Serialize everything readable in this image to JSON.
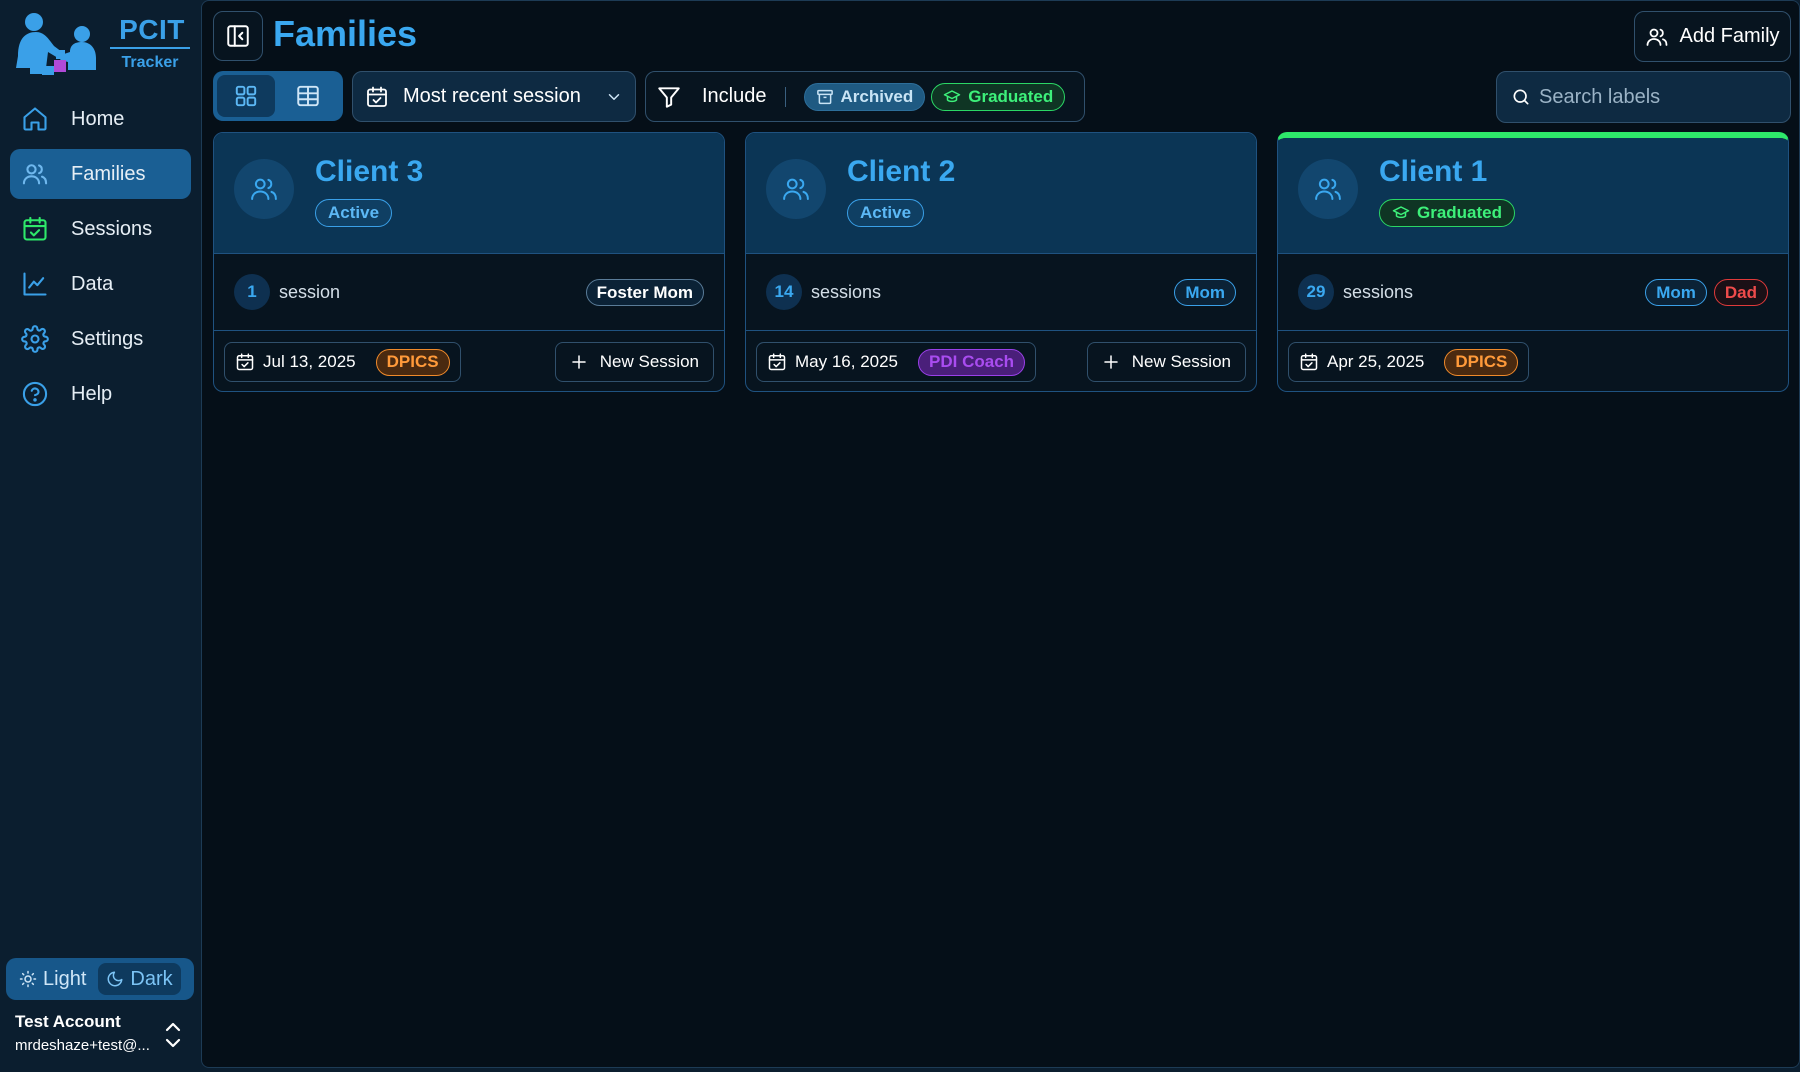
{
  "app": {
    "logo_title": "PCIT",
    "logo_subtitle": "Tracker"
  },
  "sidebar": {
    "items": [
      {
        "label": "Home",
        "icon": "home-icon",
        "active": false
      },
      {
        "label": "Families",
        "icon": "users-icon",
        "active": true
      },
      {
        "label": "Sessions",
        "icon": "calendar-check-icon",
        "active": false
      },
      {
        "label": "Data",
        "icon": "line-chart-icon",
        "active": false
      },
      {
        "label": "Settings",
        "icon": "gear-icon",
        "active": false
      },
      {
        "label": "Help",
        "icon": "help-circle-icon",
        "active": false
      }
    ],
    "theme": {
      "light_label": "Light",
      "dark_label": "Dark",
      "selected": "Dark"
    },
    "account": {
      "name": "Test Account",
      "email": "mrdeshaze+test@..."
    }
  },
  "header": {
    "title": "Families",
    "add_family_label": "Add Family"
  },
  "toolbar": {
    "view_modes": [
      "grid",
      "table"
    ],
    "view_selected": "grid",
    "sort_value": "Most recent session",
    "filter_label": "Include",
    "filter_chips": [
      {
        "label": "Archived",
        "icon": "archive-icon"
      },
      {
        "label": "Graduated",
        "icon": "graduation-cap-icon"
      }
    ],
    "search_placeholder": "Search labels"
  },
  "colors": {
    "accent": "#3aa8f0",
    "active_nav": "#1a5f94",
    "graduated": "#2ee86a",
    "dpics": "#ff9a3a",
    "pdi_coach": "#a94cf0",
    "dad_tag": "#ee4b4b"
  },
  "families": [
    {
      "name": "Client 3",
      "status": "Active",
      "session_count": "1",
      "session_unit": "session",
      "labels": [
        {
          "text": "Foster Mom",
          "kind": "foster"
        }
      ],
      "last_session_date": "Jul 13, 2025",
      "last_session_type": "DPICS",
      "new_session_label": "New Session"
    },
    {
      "name": "Client 2",
      "status": "Active",
      "session_count": "14",
      "session_unit": "sessions",
      "labels": [
        {
          "text": "Mom",
          "kind": "mom"
        }
      ],
      "last_session_date": "May 16, 2025",
      "last_session_type": "PDI Coach",
      "new_session_label": "New Session"
    },
    {
      "name": "Client 1",
      "status": "Graduated",
      "session_count": "29",
      "session_unit": "sessions",
      "labels": [
        {
          "text": "Mom",
          "kind": "mom"
        },
        {
          "text": "Dad",
          "kind": "dad"
        }
      ],
      "last_session_date": "Apr 25, 2025",
      "last_session_type": "DPICS"
    }
  ]
}
